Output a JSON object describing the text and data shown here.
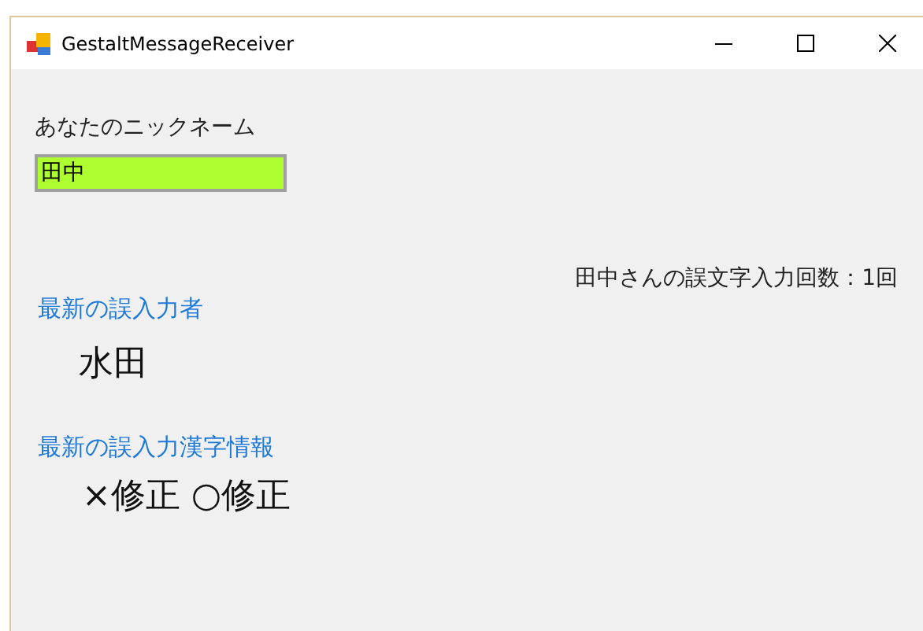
{
  "window": {
    "title": "GestaltMessageReceiver"
  },
  "nickname": {
    "label": "あなたのニックネーム",
    "value": "田中"
  },
  "error_count": "田中さんの誤文字入力回数：1回",
  "latest_user": {
    "label": "最新の誤入力者",
    "value": "水田"
  },
  "latest_kanji": {
    "label": "最新の誤入力漢字情報",
    "value": "×修正 ○修正"
  }
}
